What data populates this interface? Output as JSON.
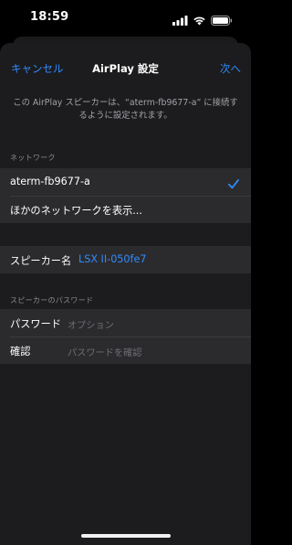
{
  "status_bar": {
    "time": "18:59",
    "icons": [
      "cellular-signal-icon",
      "wifi-icon",
      "battery-icon"
    ]
  },
  "nav": {
    "cancel_label": "キャンセル",
    "title": "AirPlay 設定",
    "next_label": "次へ"
  },
  "description": "この AirPlay スピーカーは、“aterm-fb9677-a” に接続するように設定されます。",
  "network": {
    "header": "ネットワーク",
    "items": [
      {
        "label": "aterm-fb9677-a",
        "selected": true
      },
      {
        "label": "ほかのネットワークを表示..."
      }
    ]
  },
  "speaker": {
    "label": "スピーカー名",
    "value": "LSX II-050fe7"
  },
  "password": {
    "header": "スピーカーのパスワード",
    "fields": [
      {
        "label": "パスワード",
        "placeholder": "オプション"
      },
      {
        "label": "確認",
        "placeholder": "パスワードを確認"
      }
    ]
  },
  "colors": {
    "accent": "#2f8bff",
    "sheet": "#1c1c1e",
    "cell": "#2b2b2e"
  }
}
